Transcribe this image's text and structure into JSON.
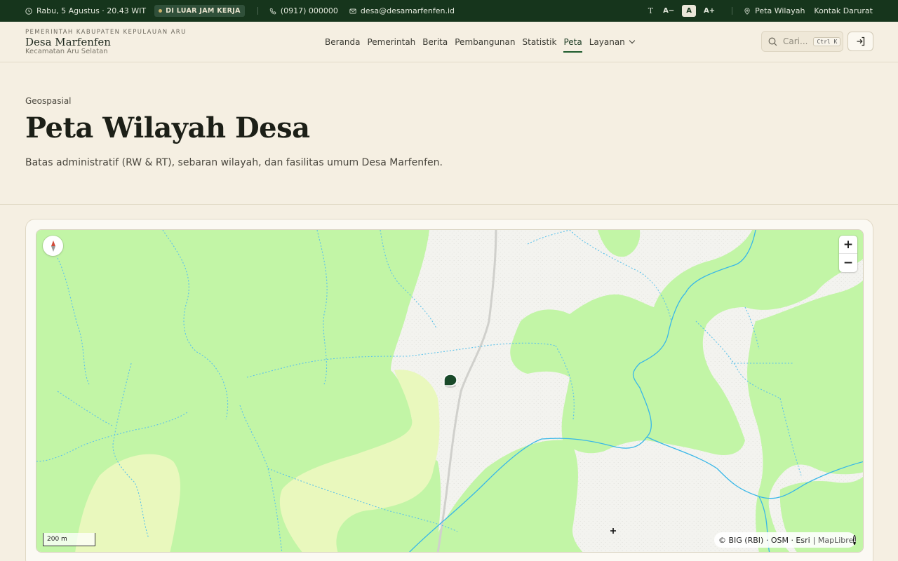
{
  "topbar": {
    "datetime": "Rabu, 5 Agustus · 20.43 WIT",
    "status_badge": "DI LUAR JAM KERJA",
    "phone": "(0917) 000000",
    "email": "desa@desamarfenfen.id",
    "text_size_icon": "T",
    "font_decrease": "A−",
    "font_normal": "A",
    "font_increase": "A+",
    "map_link": "Peta Wilayah",
    "emergency_link": "Kontak Darurat"
  },
  "header": {
    "gov_name": "PEMERINTAH KABUPATEN KEPULAUAN ARU",
    "village_name": "Desa Marfenfen",
    "district": "Kecamatan Aru Selatan",
    "nav": [
      "Beranda",
      "Pemerintah",
      "Berita",
      "Pembangunan",
      "Statistik",
      "Peta",
      "Layanan"
    ],
    "active_nav": "Peta",
    "search_placeholder": "Cari...",
    "search_shortcut": "Ctrl K"
  },
  "hero": {
    "eyebrow": "Geospasial",
    "title": "Peta Wilayah Desa",
    "description": "Batas administratif (RW & RT), sebaran wilayah, dan fasilitas umum Desa Marfenfen."
  },
  "map": {
    "scale_label": "200 m",
    "attribution": "© BIG (RBI) · OSM · Esri",
    "attribution_lib": "| MapLibre",
    "zoom_in": "+",
    "zoom_out": "−",
    "info": "i",
    "colors": {
      "forest": "#c2f5a6",
      "shrub": "#e7f8bb",
      "open_land": "#f2f2ee",
      "river": "#38b7e8",
      "stream": "#5cc2ea",
      "road": "#cfcfcf",
      "marker": "#1a4a2a"
    }
  }
}
